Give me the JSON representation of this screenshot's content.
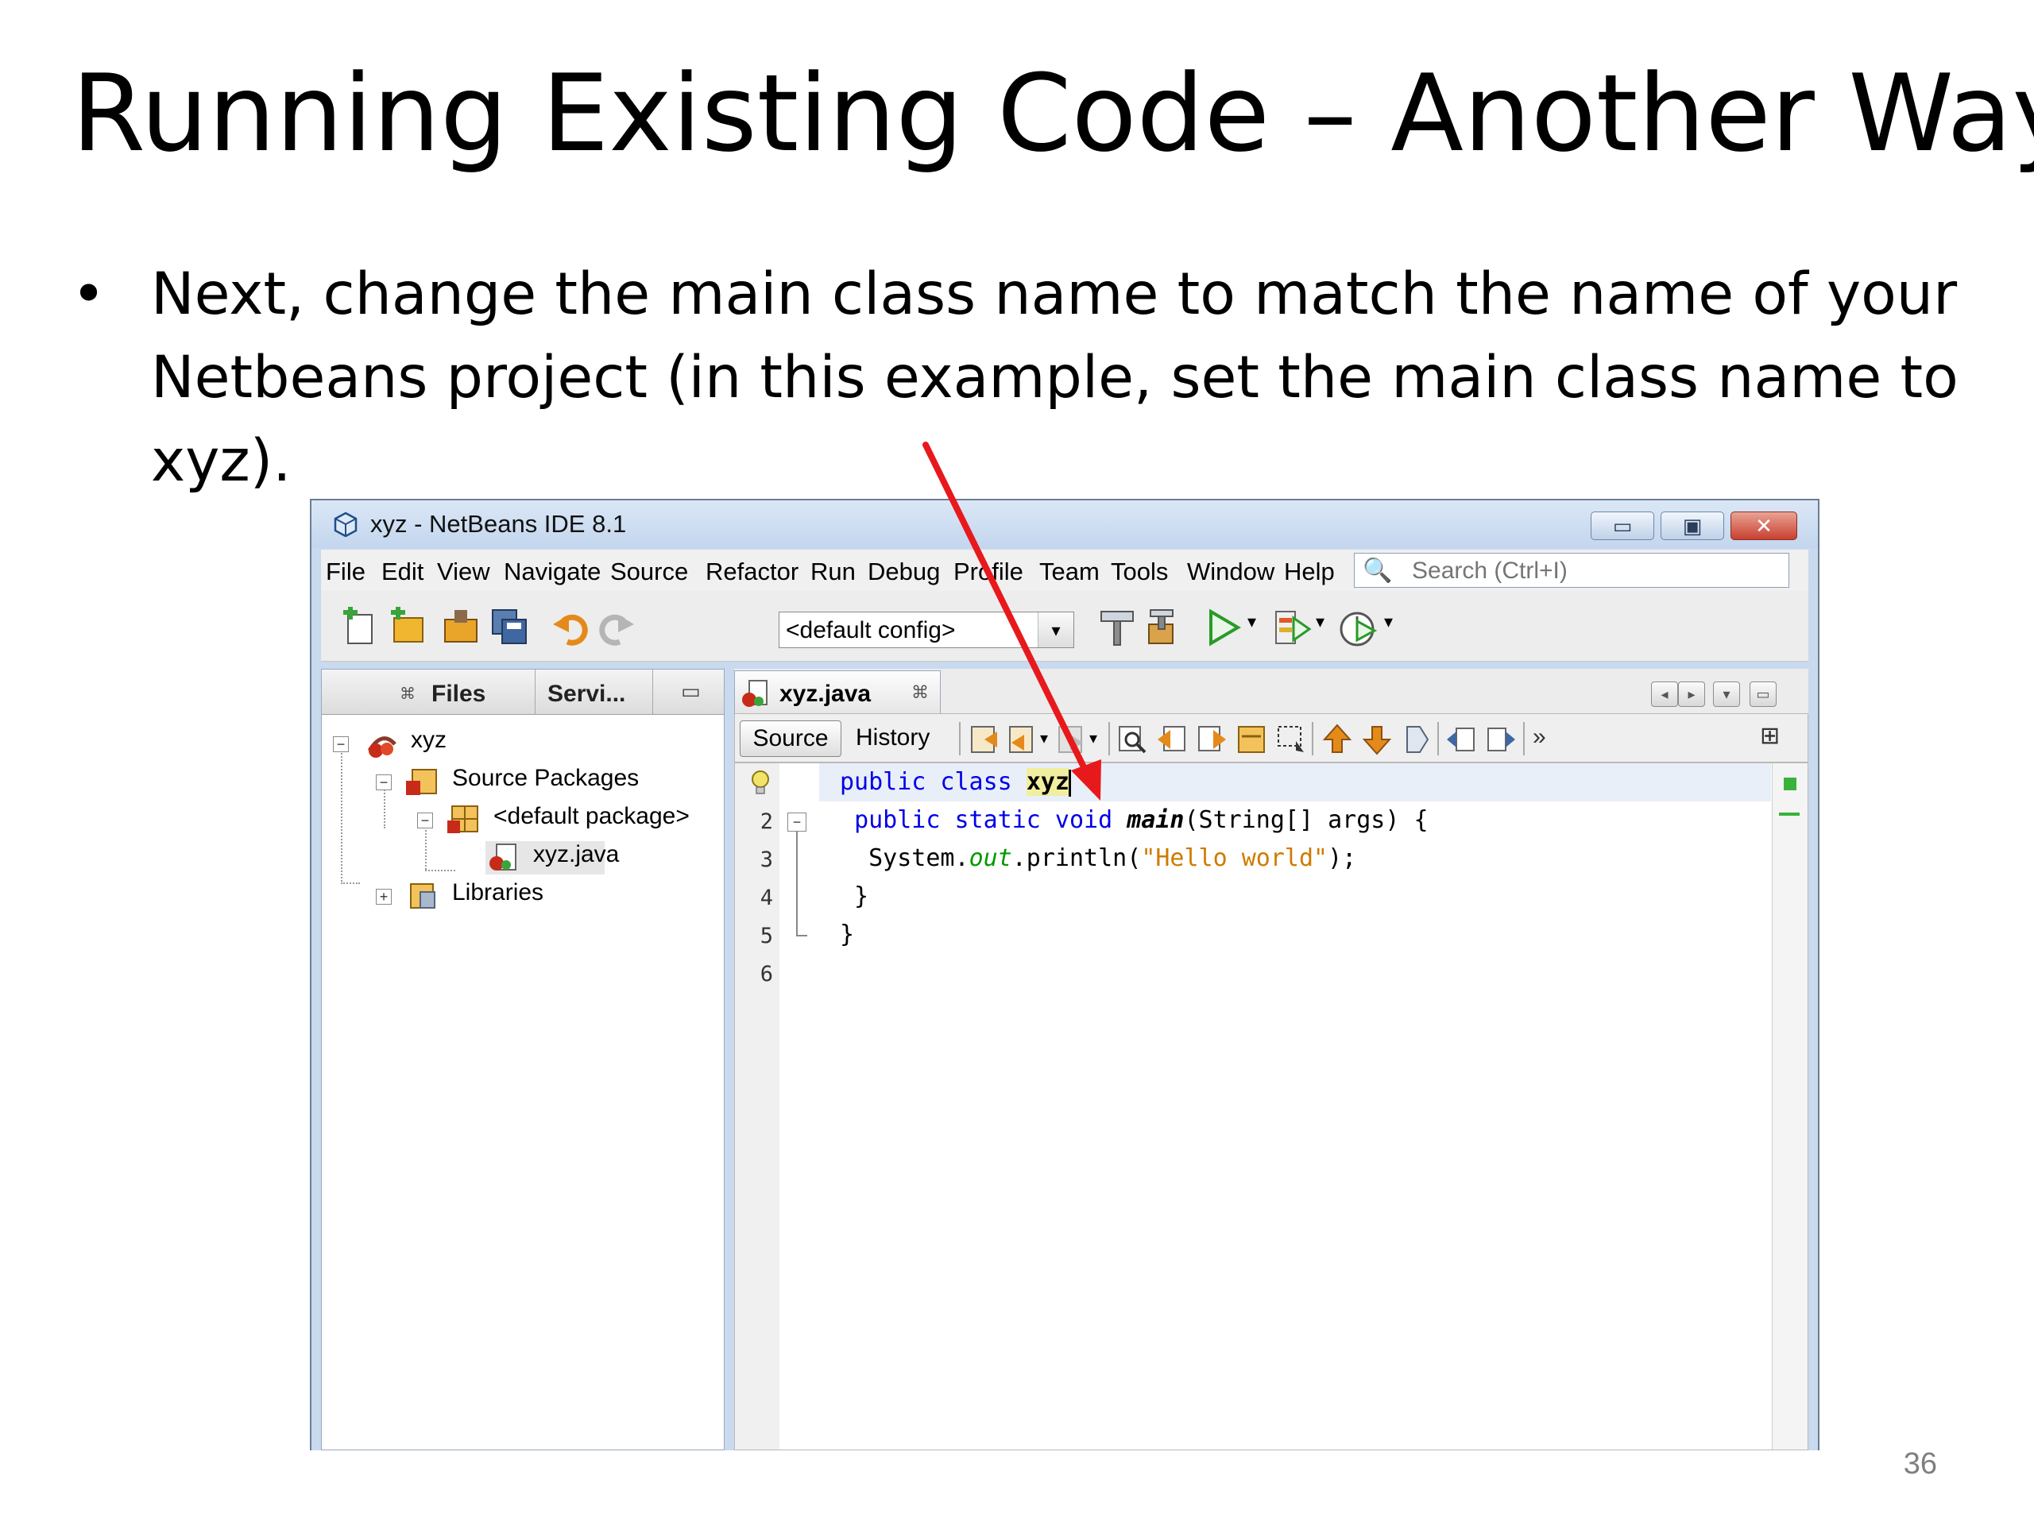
{
  "slide": {
    "title": "Running Existing Code – Another Way",
    "bullet_symbol": "•",
    "bullet_text": "Next, change the main class name to match the name of your Netbeans project (in this example, set the main class name to xyz).",
    "page_number": "36"
  },
  "window": {
    "title": "xyz - NetBeans IDE 8.1",
    "minimize": "▭",
    "maximize": "▣",
    "close": "✕"
  },
  "menu": {
    "items": [
      "File",
      "Edit",
      "View",
      "Navigate",
      "Source",
      "Refactor",
      "Run",
      "Debug",
      "Profile",
      "Team",
      "Tools",
      "Window",
      "Help"
    ],
    "search_placeholder": "Search (Ctrl+I)"
  },
  "toolbar": {
    "config_value": "<default config>",
    "config_arrow": "▾"
  },
  "projects": {
    "tab_close": "⌘",
    "tabs": [
      "Files",
      "Servi..."
    ],
    "minimize": "▭",
    "tree": [
      {
        "label": "xyz",
        "expander": "−"
      },
      {
        "label": "Source Packages",
        "expander": "−"
      },
      {
        "label": "<default package>",
        "expander": "−"
      },
      {
        "label": "xyz.java",
        "expander": ""
      },
      {
        "label": "Libraries",
        "expander": "+"
      }
    ]
  },
  "editor": {
    "tab_label": "xyz.java",
    "tab_close": "⌘",
    "source_tab": "Source",
    "history_tab": "History",
    "more": "»",
    "line_numbers": [
      "",
      "2",
      "3",
      "4",
      "5",
      "6"
    ],
    "code": {
      "l1_kw": "public class ",
      "l1_name": "xyz",
      "l1_rest": " {",
      "l2_indent": " ",
      "l2_kw": "public static void ",
      "l2_method": "main",
      "l2_rest": "(String[] args) {",
      "l3_a": "  System.",
      "l3_field": "out",
      "l3_b": ".println(",
      "l3_str": "\"Hello world\"",
      "l3_c": ");",
      "l4": " }",
      "l5": "}"
    }
  },
  "colors": {
    "annotation_arrow": "#e8191c",
    "keyword": "#0000e6",
    "string": "#ce7b00",
    "field": "#009900"
  }
}
